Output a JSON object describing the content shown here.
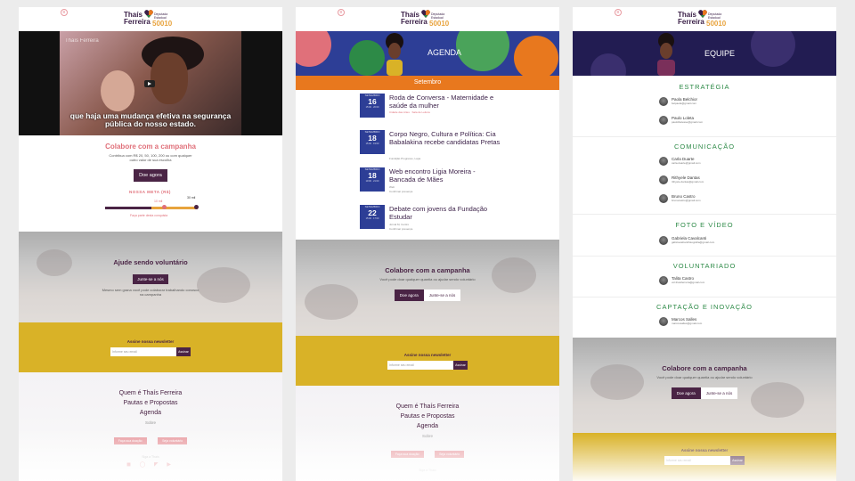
{
  "brand": {
    "first": "Thaís",
    "last": "Ferreira",
    "role": "Deputada Estadual",
    "number": "50010"
  },
  "colors": {
    "purple": "#4a2445",
    "pink": "#e0707a",
    "yellow": "#d9b227",
    "blue": "#2d3e96",
    "orange": "#e8781e",
    "green": "#2d8a47"
  },
  "m1": {
    "video_caption": "que haja uma mudança efetiva na segurança pública do nosso estado.",
    "video_watermark": "Thaís Ferreira",
    "collab_title": "Colabore com a campanha",
    "collab_text": "Contribua com R$ 20, 50, 100, 200 ou com qualquer outro valor de sua escolha",
    "donate_btn": "Doe agora",
    "goal_title": "NOSSA META (R$)",
    "goal_current": "10 mil",
    "goal_target": "30 mil",
    "goal_foot": "Faça parte desta conquista",
    "vol_title": "Ajude sendo voluntário",
    "vol_btn": "Junte-se a nós",
    "vol_text": "Mesmo sem grana você pode colaborar trabalhando conosco na campanha",
    "news_title": "Assine nossa newsletter",
    "news_placeholder": "Informe seu email",
    "news_btn": "Assinar",
    "footer_links": [
      "Quem é Thaís Ferreira",
      "Pautas e Propostas",
      "Agenda"
    ],
    "footer_exit": "Sobre",
    "footer_btn1": "Faça sua doação",
    "footer_btn2": "Seja voluntário",
    "footer_follow": "Siga a Thaís",
    "social_icons": "◼ ◯ ◤ ▶"
  },
  "m2": {
    "hero_title": "AGENDA",
    "month": "Setembro",
    "events": [
      {
        "month": "SETEMBRO",
        "day": "16",
        "hour": "15:00 · 20:00",
        "title": "Roda de Conversa - Maternidade e saúde da mulher",
        "loc": "Cidade das Artes · Sala de Leitura"
      },
      {
        "month": "SETEMBRO",
        "day": "18",
        "hour": "15:00 · 19:00",
        "title": "Corpo Negro, Cultura e Política: Cia Babalakina recebe candidatas Pretas",
        "loc": "Fundição Progresso, Lapa"
      },
      {
        "month": "SETEMBRO",
        "day": "18",
        "hour": "19:00 · 21:00",
        "title": "Web encontro Ligia Moreira - Bancada de Mães",
        "loc": "Confirmar presença"
      },
      {
        "month": "SETEMBRO",
        "day": "22",
        "hour": "15:00 · 17:00",
        "title": "Debate com jovens da Fundação Estudar",
        "loc": "Confirmar presença"
      }
    ],
    "ev1_pre": "Web",
    "ev3_pre": "Jornal M, Centro",
    "collab_title": "Colabore com a campanha",
    "collab_text": "Você pode doar qualquer quantia ou ajudar sendo voluntário",
    "btn1": "Doe agora",
    "btn2": "Junte-se a nós",
    "news_title": "Assine nossa newsletter",
    "news_placeholder": "Informe seu email",
    "news_btn": "Assinar",
    "footer_links": [
      "Quem é Thaís Ferreira",
      "Pautas e Propostas",
      "Agenda"
    ],
    "footer_exit": "Sobre",
    "footer_btn1": "Faça sua doação",
    "footer_btn2": "Seja voluntário",
    "footer_follow": "Siga a Thaís"
  },
  "m3": {
    "hero_title": "EQUIPE",
    "sections": [
      {
        "title": "ESTRATÉGIA",
        "members": [
          {
            "name": "Paola Belchior",
            "email": "belpaola@gmail.com"
          },
          {
            "name": "Paulo Loleta",
            "email": "paulolbelesse@gmail.com"
          }
        ]
      },
      {
        "title": "COMUNICAÇÃO",
        "members": [
          {
            "name": "Carla Duarte",
            "email": "carla.duarte@gmail.com"
          },
          {
            "name": "Rithyele Dantas",
            "email": "rithyele.dantas@gmail.com"
          },
          {
            "name": "Bruno Castro",
            "email": "brunocastro@gmail.com"
          }
        ]
      },
      {
        "title": "FOTO E VÍDEO",
        "members": [
          {
            "name": "Gabriela Cavalcanti",
            "email": "gabicavalcantifotografia@gmail.com"
          }
        ]
      },
      {
        "title": "VOLUNTARIADO",
        "members": [
          {
            "name": "Talita Castro",
            "email": "vol.thaisferreira@gmail.com"
          }
        ]
      },
      {
        "title": "CAPTAÇÃO E INOVAÇÃO",
        "members": [
          {
            "name": "Marcos Salles",
            "email": "marcossalles@gmail.com"
          }
        ]
      }
    ],
    "collab_title": "Colabore com a campanha",
    "collab_text": "Você pode doar qualquer quantia ou ajudar sendo voluntário",
    "btn1": "Doe agora",
    "btn2": "Junte-se a nós",
    "news_title": "Assine nossa newsletter",
    "news_placeholder": "Informe seu email",
    "news_btn": "Assinar"
  }
}
